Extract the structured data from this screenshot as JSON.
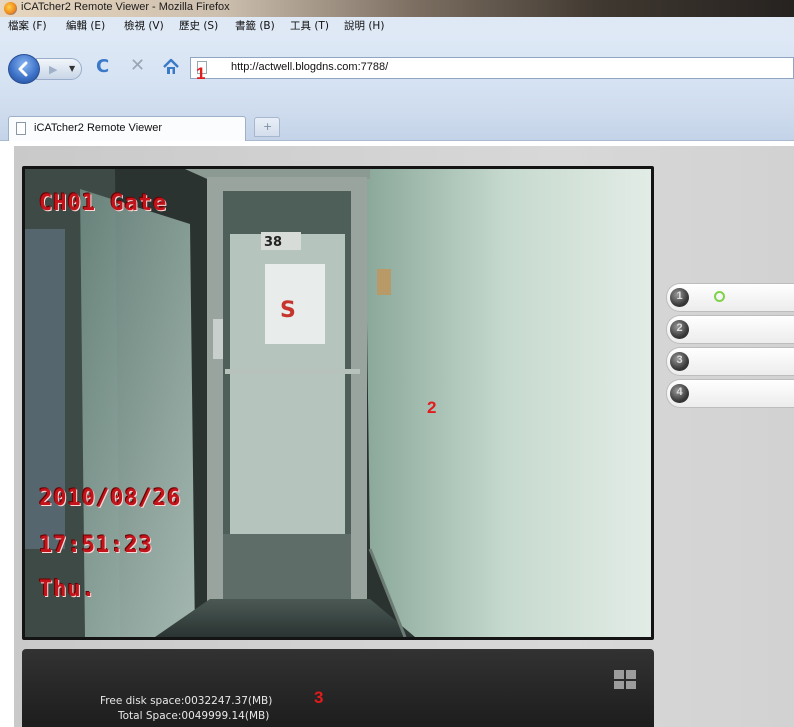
{
  "window": {
    "title": "iCATcher2 Remote Viewer - Mozilla Firefox"
  },
  "menu": {
    "items": [
      "檔案 (F)",
      "編輯 (E)",
      "檢視 (V)",
      "歷史 (S)",
      "書籤 (B)",
      "工具 (T)",
      "說明 (H)"
    ]
  },
  "toolbar": {
    "url": "http://actwell.blogdns.com:7788/",
    "back_icon": "back-arrow-icon",
    "forward_icon": "forward-arrow-icon",
    "reload_icon": "reload-icon",
    "stop_icon": "stop-icon",
    "home_icon": "home-icon"
  },
  "tabs": {
    "active_label": "iCATcher2 Remote Viewer",
    "new_tab": "+"
  },
  "callouts": [
    "1",
    "2",
    "3"
  ],
  "camera": {
    "channel_label": "CH01 Gate",
    "date": "2010/08/26",
    "time": "17:51:23",
    "weekday": "Thu.",
    "door_sign": "38"
  },
  "status": {
    "free_disk": "Free disk space:0032247.37(MB)",
    "total_space": "Total Space:0049999.14(MB)"
  },
  "channels": [
    {
      "number": "1",
      "active": true
    },
    {
      "number": "2",
      "active": false
    },
    {
      "number": "3",
      "active": false
    },
    {
      "number": "4",
      "active": false
    }
  ],
  "colors": {
    "overlay_text": "#c2141a",
    "callout": "#e21b1b",
    "active_channel": "#7fd24a"
  }
}
